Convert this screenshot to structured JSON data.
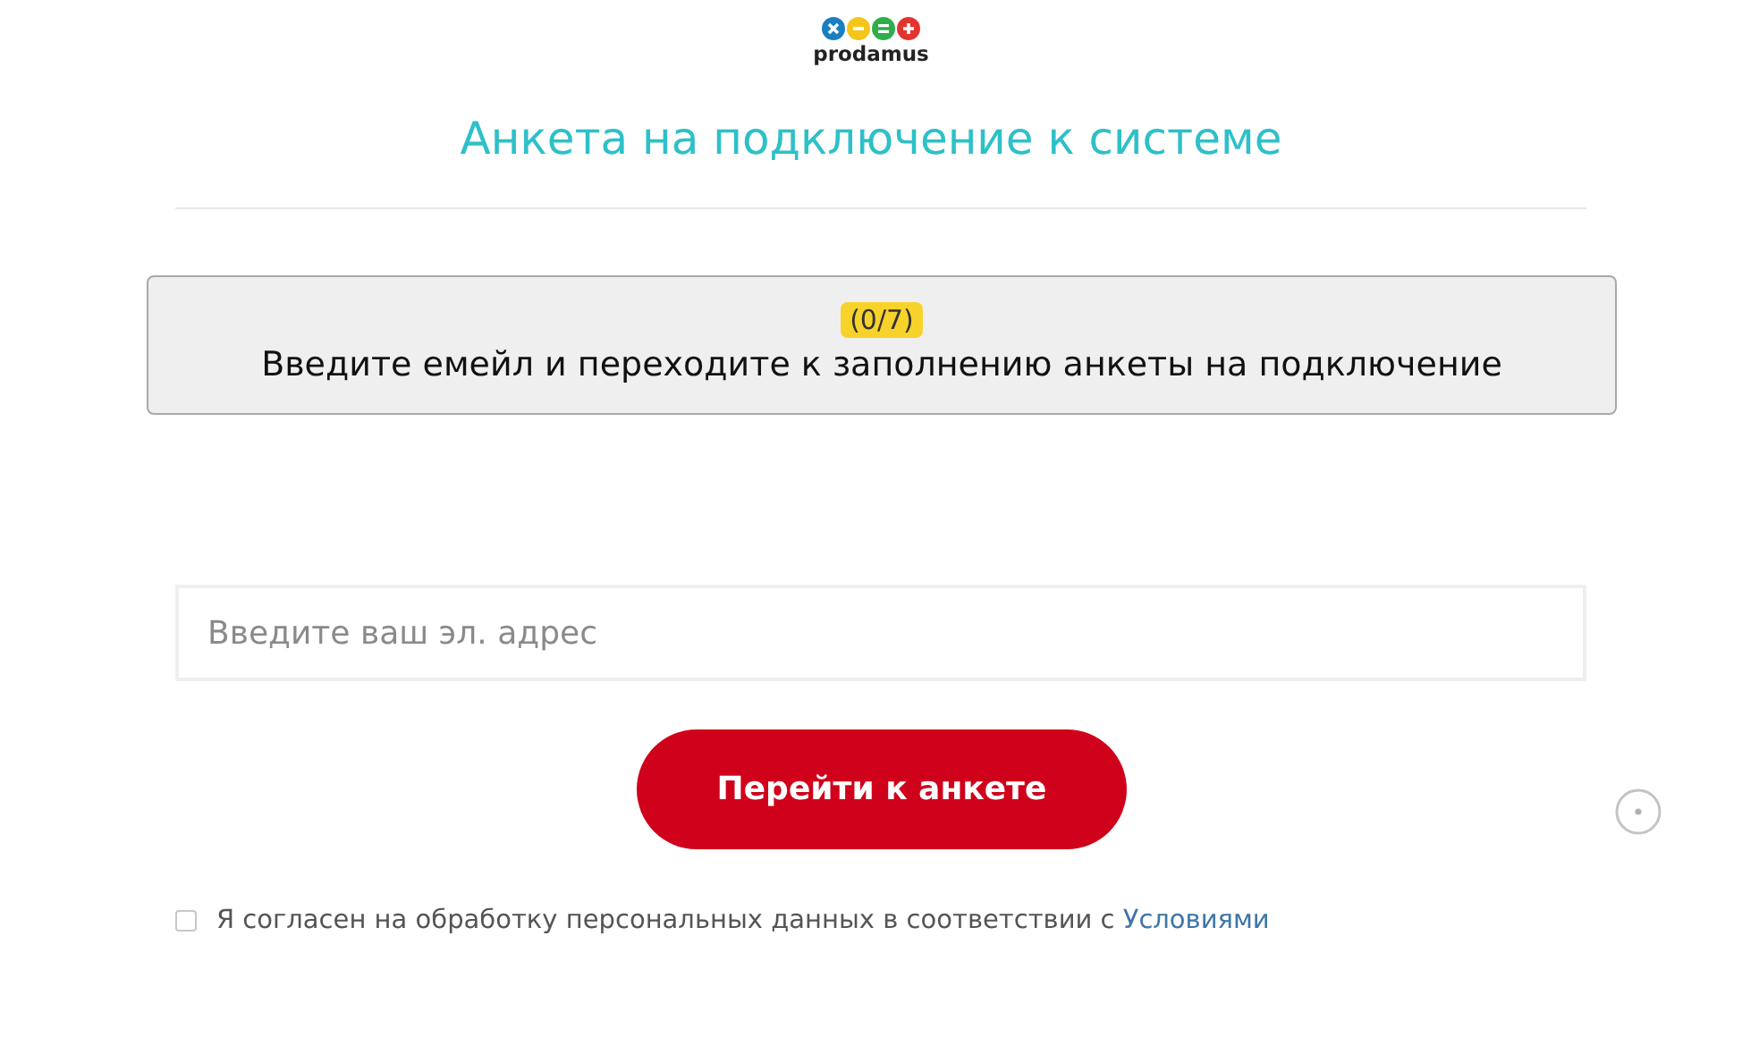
{
  "logo": {
    "text": "prodamus"
  },
  "title": "Анкета на подключение к системе",
  "notice": {
    "badge": "(0/7)",
    "text": "Введите емейл и переходите к заполнению анкеты на подключение"
  },
  "email_field": {
    "placeholder": "Введите ваш эл. адрес"
  },
  "submit_button": "Перейти к анкете",
  "consent": {
    "checked": false,
    "text": "Я согласен на обработку персональных данных в соответствии с",
    "link": "Условиями"
  }
}
